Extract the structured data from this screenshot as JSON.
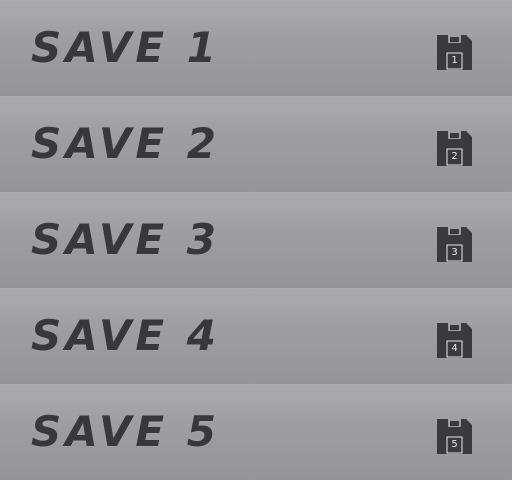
{
  "save_slots": [
    {
      "label": "SAVE 1",
      "icon": "floppy-disk-icon",
      "disk_number": "1"
    },
    {
      "label": "SAVE 2",
      "icon": "floppy-disk-icon",
      "disk_number": "2"
    },
    {
      "label": "SAVE 3",
      "icon": "floppy-disk-icon",
      "disk_number": "3"
    },
    {
      "label": "SAVE 4",
      "icon": "floppy-disk-icon",
      "disk_number": "4"
    },
    {
      "label": "SAVE 5",
      "icon": "floppy-disk-icon",
      "disk_number": "5"
    }
  ],
  "colors": {
    "background": "#9a9a9d",
    "text": "#38383b",
    "icon": "#3a3a3d",
    "icon_number": "#e8e8ea"
  }
}
